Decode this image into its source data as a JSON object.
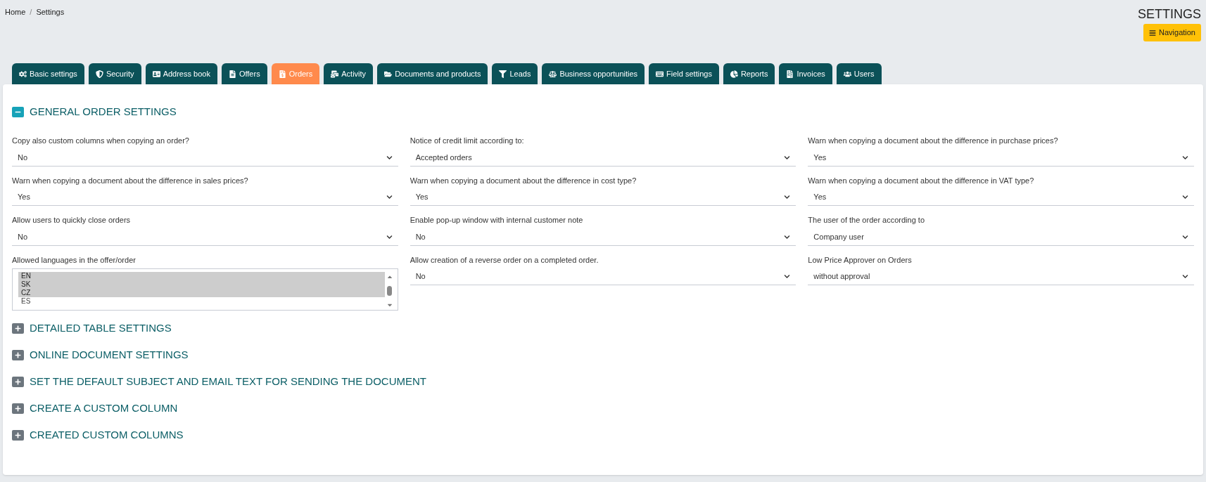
{
  "breadcrumb": [
    "Home",
    "Settings"
  ],
  "breadcrumb_separator": "/",
  "page_title": "SETTINGS",
  "navigation_button": "Navigation",
  "tabs": [
    {
      "label": "Basic settings",
      "selected": false
    },
    {
      "label": "Security",
      "selected": false
    },
    {
      "label": "Address book",
      "selected": false
    },
    {
      "label": "Offers",
      "selected": false
    },
    {
      "label": "Orders",
      "selected": true
    },
    {
      "label": "Activity",
      "selected": false
    },
    {
      "label": "Documents and products",
      "selected": false
    },
    {
      "label": "Leads",
      "selected": false
    },
    {
      "label": "Business opportunities",
      "selected": false
    },
    {
      "label": "Field settings",
      "selected": false
    },
    {
      "label": "Reports",
      "selected": false
    },
    {
      "label": "Invoices",
      "selected": false
    },
    {
      "label": "Users",
      "selected": false
    }
  ],
  "sections": [
    {
      "title": "GENERAL ORDER SETTINGS",
      "expanded": true,
      "fields": [
        {
          "kind": "select",
          "label": "Copy also custom columns when copying an order?",
          "value": "No"
        },
        {
          "kind": "select",
          "label": "Notice of credit limit according to:",
          "value": "Accepted orders"
        },
        {
          "kind": "select",
          "label": "Warn when copying a document about the difference in purchase prices?",
          "value": "Yes"
        },
        {
          "kind": "select",
          "label": "Warn when copying a document about the difference in sales prices?",
          "value": "Yes"
        },
        {
          "kind": "select",
          "label": "Warn when copying a document about the difference in cost type?",
          "value": "Yes"
        },
        {
          "kind": "select",
          "label": "Warn when copying a document about the difference in VAT type?",
          "value": "Yes"
        },
        {
          "kind": "select",
          "label": "Allow users to quickly close orders",
          "value": "No"
        },
        {
          "kind": "select",
          "label": "Enable pop-up window with internal customer note",
          "value": "No"
        },
        {
          "kind": "select",
          "label": "The user of the order according to",
          "value": "Company user"
        },
        {
          "kind": "multiselect",
          "label": "Allowed languages in the offer/order",
          "options": [
            {
              "label": "EN",
              "selected": true
            },
            {
              "label": "SK",
              "selected": true
            },
            {
              "label": "CZ",
              "selected": true
            },
            {
              "label": "ES",
              "selected": false
            }
          ]
        },
        {
          "kind": "select",
          "label": "Allow creation of a reverse order on a completed order.",
          "value": "No"
        },
        {
          "kind": "select",
          "label": "Low Price Approver on Orders",
          "value": "without approval"
        }
      ]
    },
    {
      "title": "DETAILED TABLE SETTINGS",
      "expanded": false
    },
    {
      "title": "ONLINE DOCUMENT SETTINGS",
      "expanded": false
    },
    {
      "title": "SET THE DEFAULT SUBJECT AND EMAIL TEXT FOR SENDING THE DOCUMENT",
      "expanded": false
    },
    {
      "title": "CREATE A CUSTOM COLUMN",
      "expanded": false
    },
    {
      "title": "CREATED CUSTOM COLUMNS",
      "expanded": false
    }
  ]
}
